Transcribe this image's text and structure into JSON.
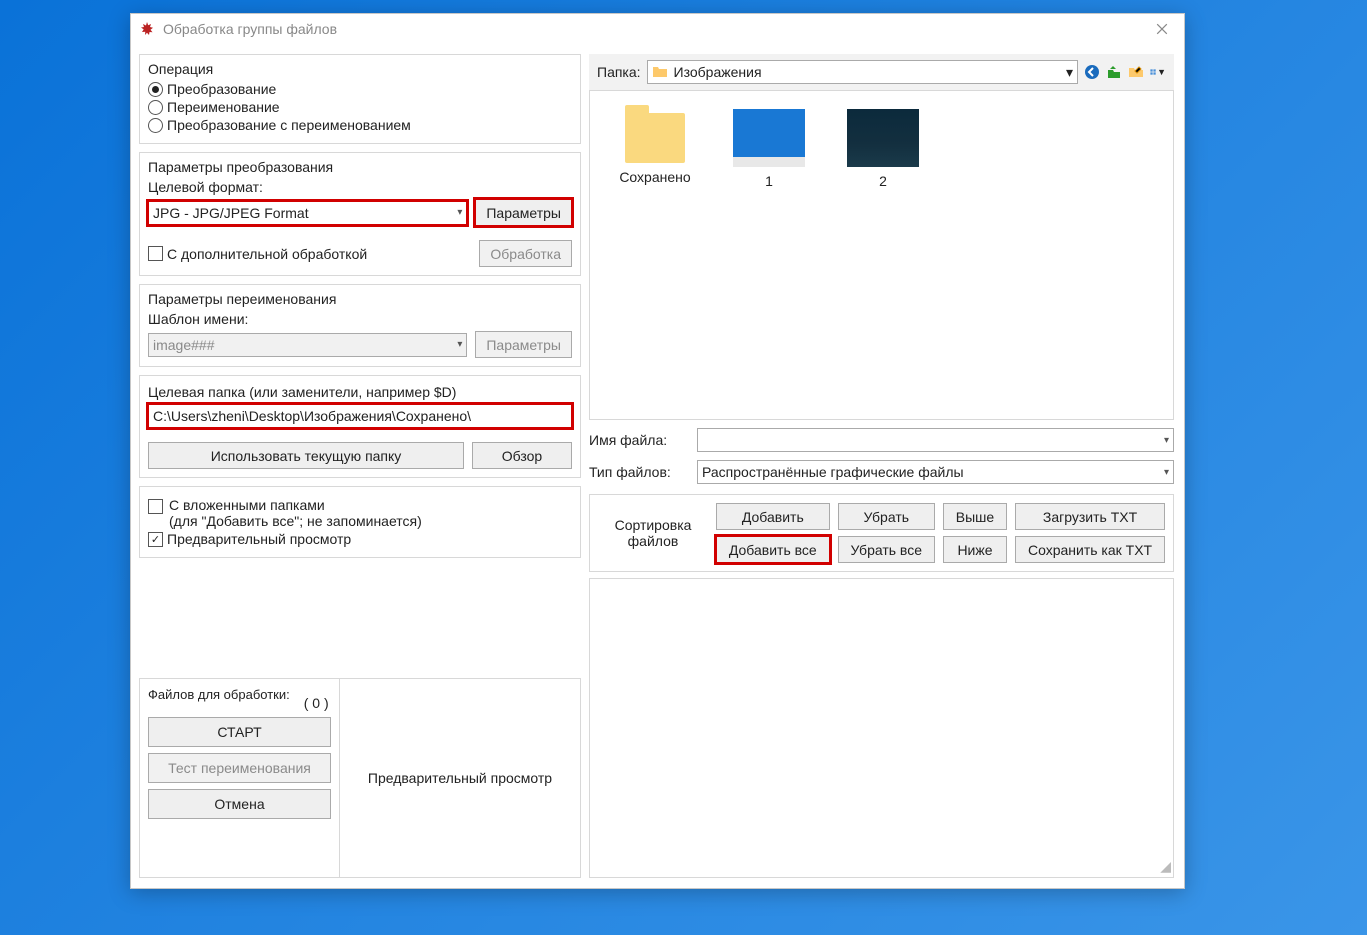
{
  "window": {
    "title": "Обработка группы файлов"
  },
  "operation": {
    "legend": "Операция",
    "opt_convert": "Преобразование",
    "opt_rename": "Переименование",
    "opt_both": "Преобразование с переименованием"
  },
  "convert": {
    "legend": "Параметры преобразования",
    "target_fmt_label": "Целевой формат:",
    "target_fmt_value": "JPG - JPG/JPEG Format",
    "params_btn": "Параметры",
    "extra_processing": "С дополнительной обработкой",
    "processing_btn": "Обработка"
  },
  "rename": {
    "legend": "Параметры переименования",
    "pattern_label": "Шаблон имени:",
    "pattern_value": "image###",
    "params_btn": "Параметры"
  },
  "target_dir": {
    "legend": "Целевая папка (или заменители, например $D)",
    "path": "C:\\Users\\zheni\\Desktop\\Изображения\\Сохранено\\",
    "use_current": "Использовать текущую папку",
    "browse": "Обзор"
  },
  "options": {
    "subfolders_line1": "С вложенными папками",
    "subfolders_line2": "(для \"Добавить все\"; не запоминается)",
    "preview": "Предварительный просмотр"
  },
  "summary": {
    "files_for": "Файлов для обработки:",
    "count": "( 0 )",
    "start": "СТАРТ",
    "test_rename": "Тест переименования",
    "cancel": "Отмена",
    "preview_pane": "Предварительный просмотр"
  },
  "browser": {
    "folder_label": "Папка:",
    "folder_value": "Изображения",
    "thumbs": {
      "folder": "Сохранено",
      "img1": "1",
      "img2": "2"
    },
    "filename_label": "Имя файла:",
    "filename_value": "",
    "filetype_label": "Тип файлов:",
    "filetype_value": "Распространённые графические файлы"
  },
  "actions": {
    "sort_hdr1": "Сортировка",
    "sort_hdr2": "файлов",
    "add": "Добавить",
    "remove": "Убрать",
    "up": "Выше",
    "load_txt": "Загрузить TXT",
    "add_all": "Добавить все",
    "remove_all": "Убрать все",
    "down": "Ниже",
    "save_txt": "Сохранить как TXT"
  }
}
